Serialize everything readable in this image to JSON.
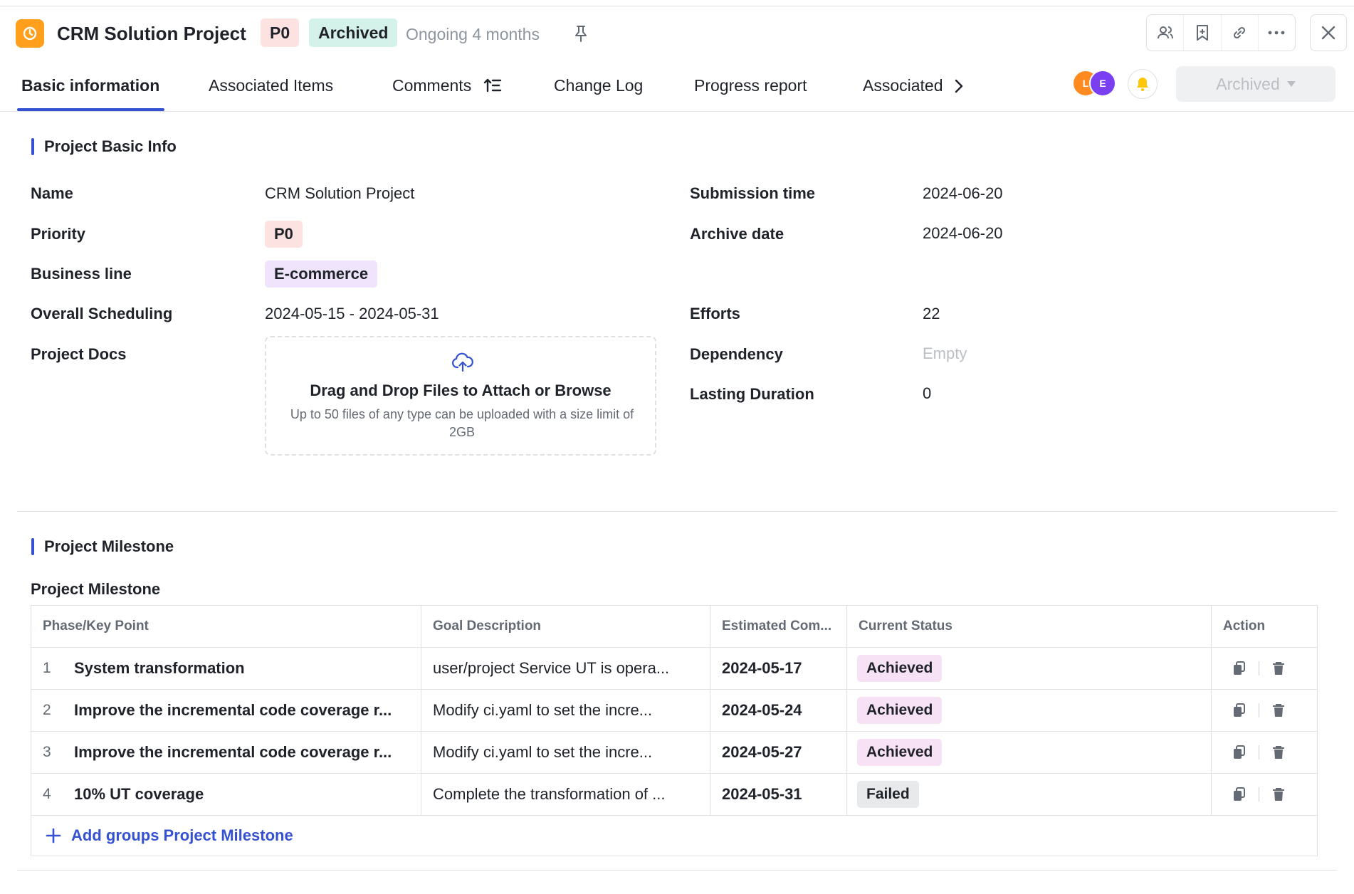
{
  "header": {
    "title": "CRM Solution Project",
    "priority_tag": "P0",
    "state_tag": "Archived",
    "duration": "Ongoing 4 months"
  },
  "tabs": [
    {
      "label": "Basic information"
    },
    {
      "label": "Associated Items"
    },
    {
      "label": "Comments"
    },
    {
      "label": "Change Log"
    },
    {
      "label": "Progress report"
    },
    {
      "label": "Associated"
    }
  ],
  "avatars": [
    "L",
    "E"
  ],
  "status_dropdown": {
    "value": "Archived"
  },
  "basic_info": {
    "section_title": "Project Basic Info",
    "name_label": "Name",
    "name_value": "CRM Solution Project",
    "priority_label": "Priority",
    "priority_value": "P0",
    "business_label": "Business line",
    "business_value": "E-commerce",
    "scheduling_label": "Overall Scheduling",
    "scheduling_value": "2024-05-15 - 2024-05-31",
    "docs_label": "Project Docs",
    "upload_title": "Drag and Drop Files to Attach or Browse",
    "upload_sub": "Up to 50 files of any type can be uploaded with a size limit of 2GB",
    "submission_label": "Submission time",
    "submission_value": "2024-06-20",
    "archive_label": "Archive date",
    "archive_value": "2024-06-20",
    "efforts_label": "Efforts",
    "efforts_value": "22",
    "dependency_label": "Dependency",
    "dependency_value": "Empty",
    "lasting_label": "Lasting Duration",
    "lasting_value": "0"
  },
  "milestone": {
    "section_title": "Project Milestone",
    "table_title": "Project Milestone",
    "columns": {
      "phase": "Phase/Key Point",
      "goal": "Goal Description",
      "est": "Estimated Com...",
      "status": "Current Status",
      "action": "Action"
    },
    "rows": [
      {
        "num": "1",
        "phase": "System transformation",
        "goal": "user/project Service UT is opera...",
        "est": "2024-05-17",
        "status": "Achieved"
      },
      {
        "num": "2",
        "phase": "Improve the incremental code coverage r...",
        "goal": "Modify ci.yaml to set the incre...",
        "est": "2024-05-24",
        "status": "Achieved"
      },
      {
        "num": "3",
        "phase": "Improve the incremental code coverage r...",
        "goal": "Modify ci.yaml to set the incre...",
        "est": "2024-05-27",
        "status": "Achieved"
      },
      {
        "num": "4",
        "phase": "10% UT coverage",
        "goal": "Complete the transformation of ...",
        "est": "2024-05-31",
        "status": "Failed"
      }
    ],
    "add_label": "Add groups Project Milestone"
  }
}
